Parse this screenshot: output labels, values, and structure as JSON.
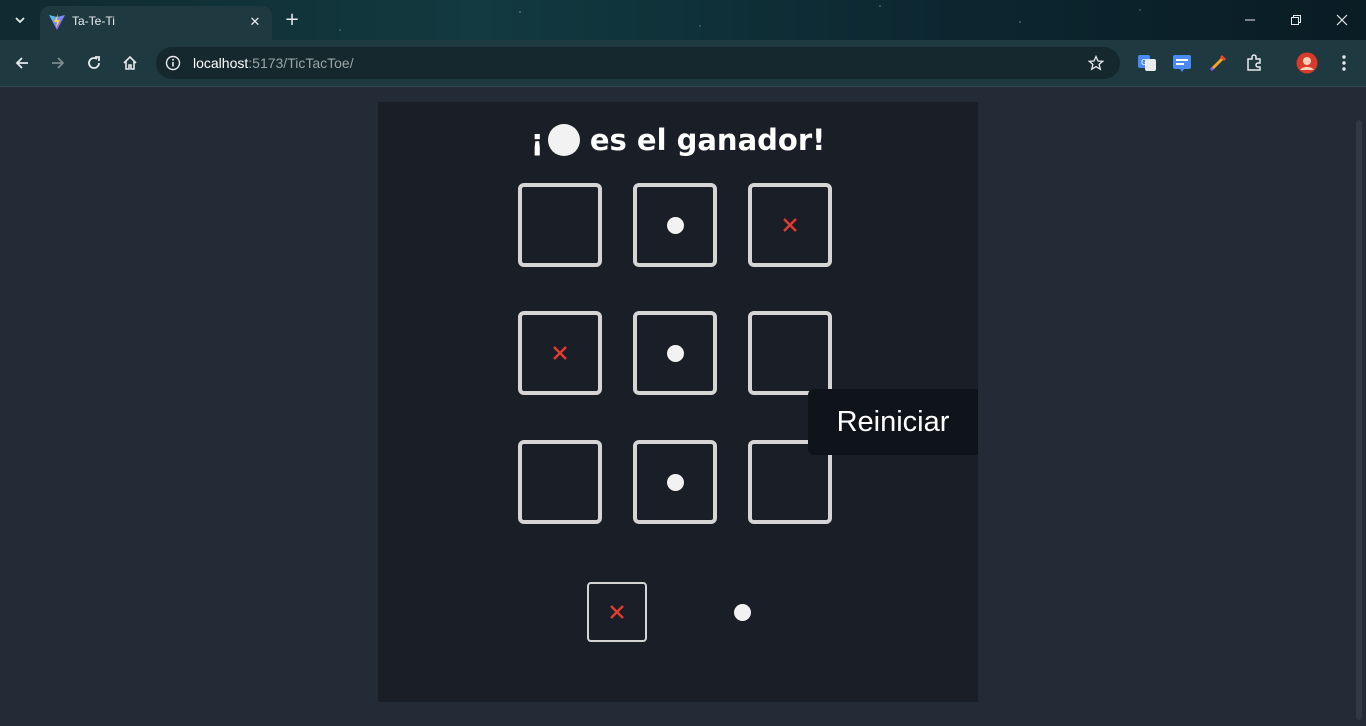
{
  "browser": {
    "tab_title": "Ta-Te-Ti",
    "url_host": "localhost",
    "url_path": ":5173/TicTacToe/",
    "icons": [
      "tab-search-icon",
      "close-icon",
      "new-tab-icon",
      "minimize-icon",
      "restore-icon",
      "window-close-icon",
      "back-icon",
      "forward-icon",
      "reload-icon",
      "home-icon",
      "site-info-icon",
      "bookmark-star-icon",
      "translate-icon",
      "extension-icon",
      "pen-icon",
      "puzzle-icon",
      "profile-icon",
      "menu-icon"
    ]
  },
  "game": {
    "winner_prefix": "¡",
    "winner_piece": "O",
    "winner_suffix": "es el ganador!",
    "board": [
      "",
      "O",
      "X",
      "X",
      "O",
      "",
      "",
      "O",
      ""
    ],
    "turn": {
      "x_symbol": "X",
      "o_symbol": "O",
      "active": "X"
    },
    "reset_label": "Reiniciar",
    "colors": {
      "x": "#e33b2e",
      "o": "#f2f2f2",
      "panel": "#1a1f27",
      "page": "#222b36",
      "cell_border": "#d5d5d5",
      "button": "#0f141a"
    }
  }
}
